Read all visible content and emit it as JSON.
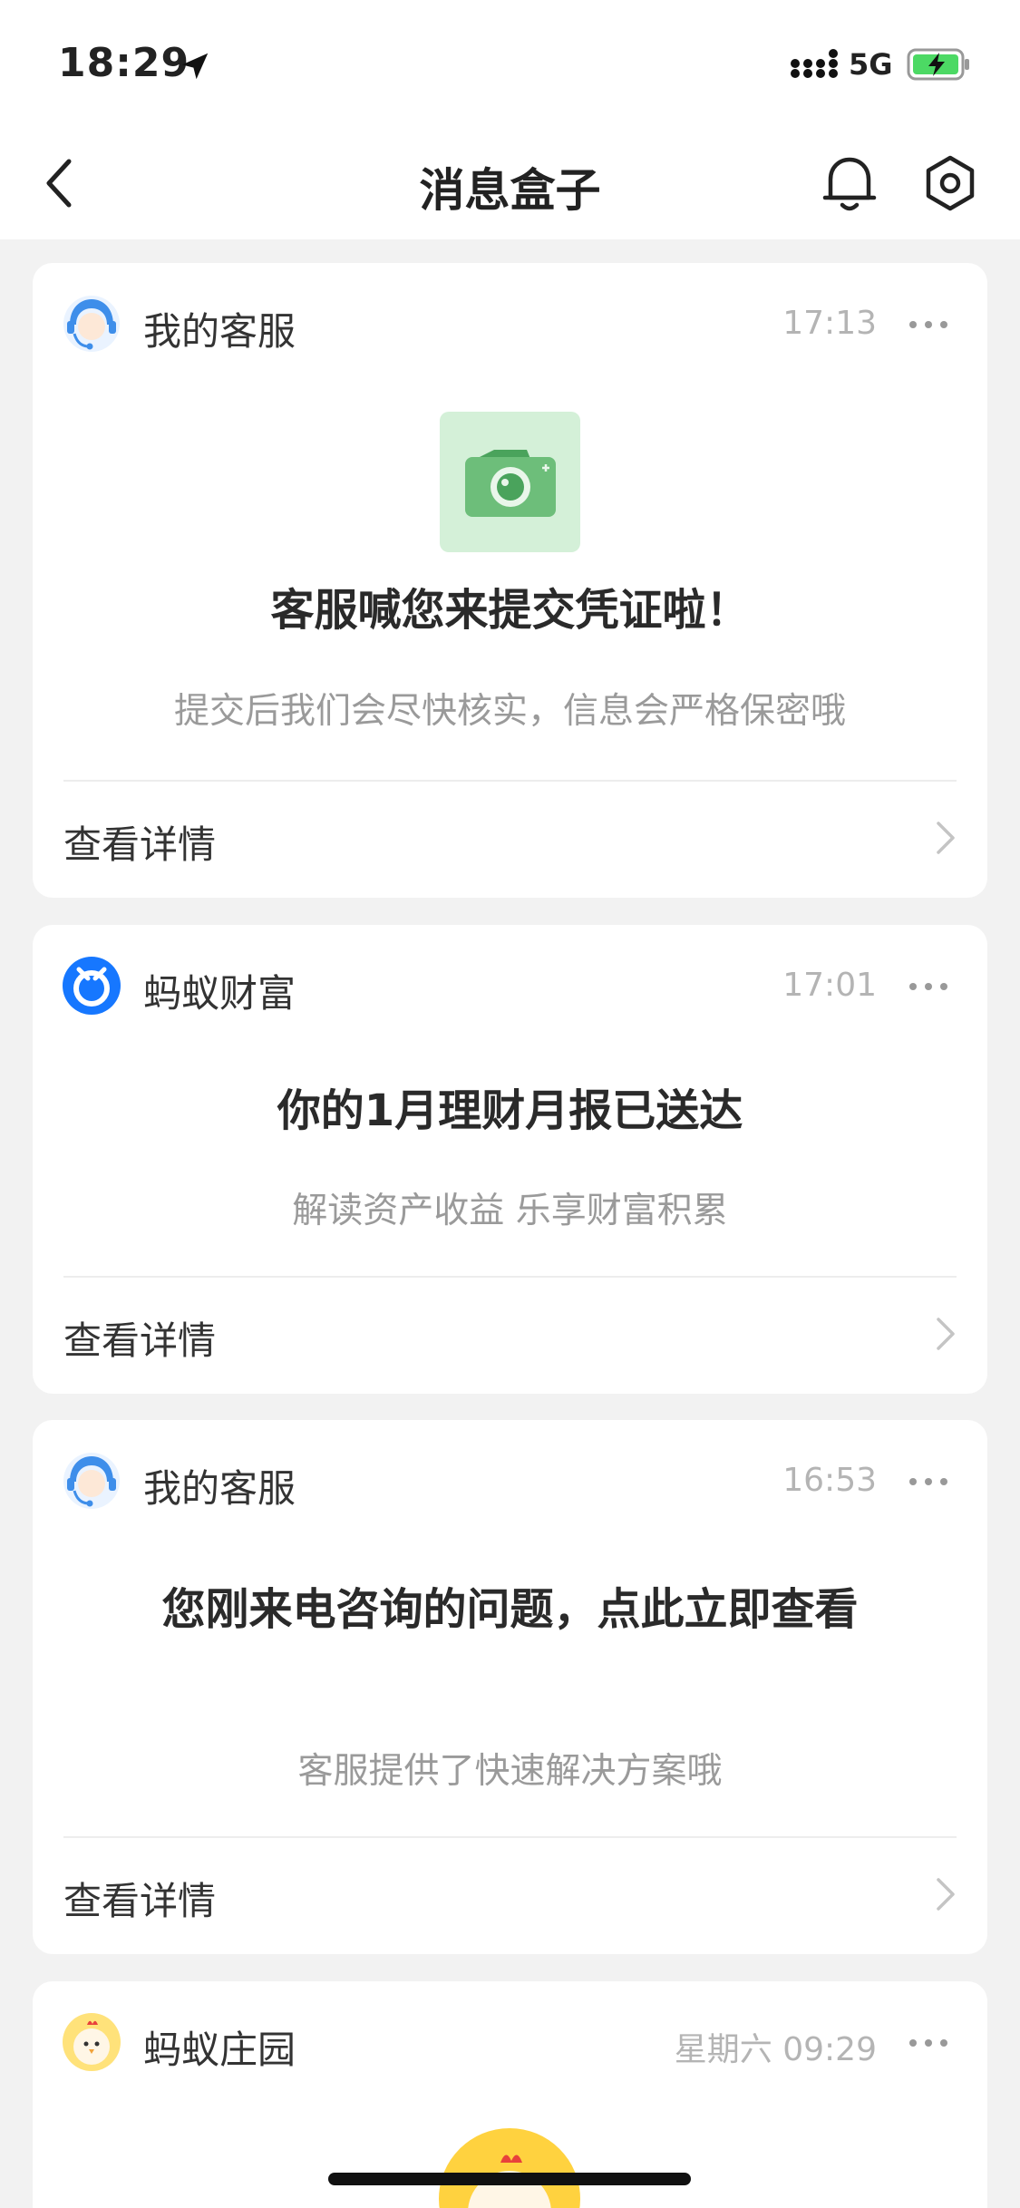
{
  "status_bar": {
    "time": "18:29",
    "network": "5G",
    "signal_icon": "signal-bars-icon",
    "battery_icon": "battery-charging-icon"
  },
  "nav": {
    "title": "消息盒子",
    "back_icon": "chevron-left-icon",
    "bell_icon": "bell-icon",
    "settings_icon": "gear-icon"
  },
  "messages": [
    {
      "source": "我的客服",
      "time": "17:13",
      "avatar_icon": "customer-service-avatar",
      "image_icon": "camera-icon",
      "title": "客服喊您来提交凭证啦！",
      "subtitle": "提交后我们会尽快核实，信息会严格保密哦",
      "action": "查看详情"
    },
    {
      "source": "蚂蚁财富",
      "time": "17:01",
      "avatar_icon": "ant-fortune-logo",
      "title": "你的1月理财月报已送达",
      "subtitle": "解读资产收益 乐享财富积累",
      "action": "查看详情"
    },
    {
      "source": "我的客服",
      "time": "16:53",
      "avatar_icon": "customer-service-avatar",
      "title": "您刚来电咨询的问题，点此立即查看",
      "subtitle": "客服提供了快速解决方案哦",
      "action": "查看详情"
    },
    {
      "source": "蚂蚁庄园",
      "time": "星期六 09:29",
      "avatar_icon": "chick-avatar"
    }
  ],
  "colors": {
    "accent_blue": "#1677ff",
    "camera_green": "#6dbe7a",
    "chick_yellow": "#ffd23f"
  }
}
